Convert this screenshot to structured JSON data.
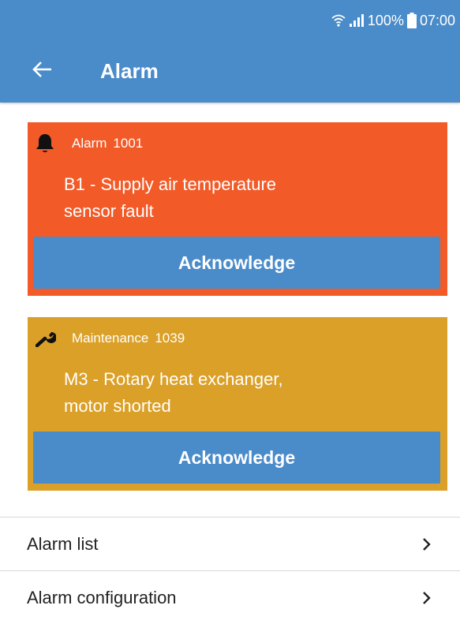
{
  "status_bar": {
    "battery": "100%",
    "time": "07:00"
  },
  "app_bar": {
    "title": "Alarm"
  },
  "cards": [
    {
      "type": "Alarm",
      "code": "1001",
      "text_line1": "B1 - Supply air temperature",
      "text_line2": "sensor fault",
      "button_label": "Acknowledge",
      "icon": "bell-icon",
      "color": "#f25a28"
    },
    {
      "type": "Maintenance",
      "code": "1039",
      "text_line1": "M3 - Rotary heat exchanger,",
      "text_line2": "motor shorted",
      "button_label": "Acknowledge",
      "icon": "wrench-icon",
      "color": "#dba027"
    }
  ],
  "menu": [
    {
      "label": "Alarm list"
    },
    {
      "label": "Alarm configuration"
    }
  ],
  "colors": {
    "primary": "#4a8bc9"
  }
}
